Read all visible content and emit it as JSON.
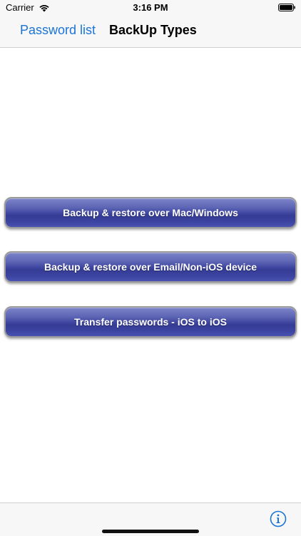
{
  "status_bar": {
    "carrier": "Carrier",
    "time": "3:16 PM",
    "wifi_icon": "wifi-icon",
    "battery_icon": "battery-icon"
  },
  "nav": {
    "back_label": "Password list",
    "title": "BackUp Types"
  },
  "buttons": [
    {
      "label": "Backup & restore over Mac/Windows"
    },
    {
      "label": "Backup & restore over Email/Non-iOS device"
    },
    {
      "label": "Transfer passwords - iOS to iOS"
    }
  ],
  "toolbar": {
    "info_icon": "info-icon"
  },
  "colors": {
    "accent": "#1a74d6",
    "button_blue": "#3f46a0"
  }
}
